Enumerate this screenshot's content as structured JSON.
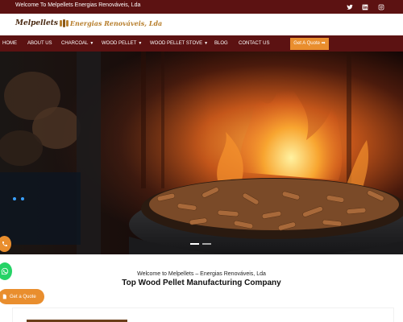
{
  "topbar": {
    "welcome_text": "Welcome To Melpellets Energias Renováveis, Lda",
    "social": [
      "twitter-icon",
      "linkedin-icon",
      "instagram-icon"
    ],
    "background": "#5c1212"
  },
  "header": {
    "brand": "Melpellets",
    "tagline": "Energias Renováveis, Lda"
  },
  "nav": {
    "items": [
      {
        "label": "HOME"
      },
      {
        "label": "ABOUT US"
      },
      {
        "label": "CHARCOAL",
        "dropdown": true
      },
      {
        "label": "WOOD PELLET",
        "dropdown": true
      },
      {
        "label": "WOOD PELLET STOVE",
        "dropdown": true
      },
      {
        "label": "BLOG"
      },
      {
        "label": "CONTACT US"
      }
    ],
    "cta": "Get A Quote ➡",
    "accent": "#e98e2e"
  },
  "hero": {
    "slides": 2,
    "active_slide": 1
  },
  "intro": {
    "welcome": "Welcome to Melpellets – Energias Renováveis, Lda",
    "headline": "Top Wood Pellet Manufacturing Company"
  },
  "floating": {
    "quote_label": "Get a Quote"
  }
}
